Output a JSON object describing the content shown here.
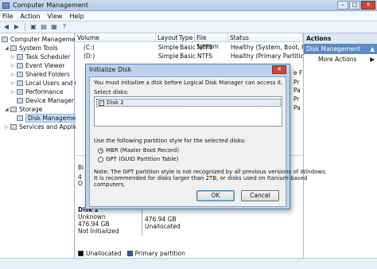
{
  "window": {
    "title": "Computer Management"
  },
  "menu": [
    "File",
    "Action",
    "View",
    "Help"
  ],
  "tree": {
    "root": "Computer Management",
    "system_tools": "System Tools",
    "task_scheduler": "Task Scheduler",
    "event_viewer": "Event Viewer",
    "shared_folders": "Shared Folders",
    "local_users": "Local Users and Gr",
    "performance": "Performance",
    "device_manager": "Device Manager",
    "storage": "Storage",
    "disk_management": "Disk Management",
    "services": "Services and Applic"
  },
  "volumes": {
    "headers": [
      "Volume",
      "Layout",
      "Type",
      "File System",
      "Status"
    ],
    "rows": [
      [
        "(C:)",
        "Simple",
        "Basic",
        "NTFS",
        "Healthy (System, Boot, Page"
      ],
      [
        "(D:)",
        "Simple",
        "Basic",
        "NTFS",
        "Healthy (Primary Partition)"
      ]
    ],
    "hidden_status_tails": [
      "e F",
      "Pr",
      "Pa",
      "Pr",
      "Pa"
    ]
  },
  "actions": {
    "header": "Actions",
    "section": "Disk Management",
    "more": "More Actions"
  },
  "disks": {
    "disk1_frag": [
      "Bi",
      "4",
      "O"
    ],
    "disk2_label": "Disk 2",
    "disk2_type": "Unknown",
    "disk2_size": "476.94 GB",
    "disk2_status": "Not Initialized",
    "part_size": "476.94 GB",
    "part_label": "Unallocated"
  },
  "legend": {
    "unallocated": "Unallocated",
    "primary": "Primary partition"
  },
  "colors": {
    "unallocated": "#000000",
    "primary": "#3a5a9c"
  },
  "dialog": {
    "title": "Initialize Disk",
    "message": "You must initialize a disk before Logical Disk Manager can access it.",
    "select_label": "Select disks:",
    "disk_item": "Disk 2",
    "style_label": "Use the following partition style for the selected disks:",
    "mbr": "MBR (Master Boot Record)",
    "gpt": "GPT (GUID Partition Table)",
    "note1": "Note: The GPT partition style is not recognized by all previous versions of Windows.",
    "note2": "It is recommended for disks larger than 2TB, or disks used on Itanium-based",
    "note3": "computers.",
    "ok": "OK",
    "cancel": "Cancel"
  }
}
